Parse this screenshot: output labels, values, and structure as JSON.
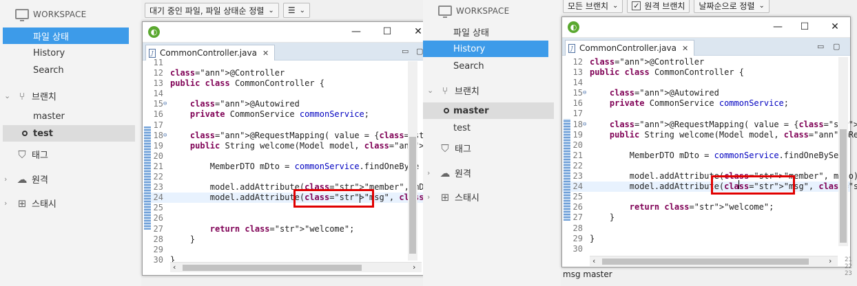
{
  "left": {
    "toolbar": {
      "filter_label": "대기 중인 파일, 파일 상태순 정렬",
      "view_label": "☰"
    },
    "sidebar": {
      "workspace": "WORKSPACE",
      "workspace_items": [
        "파일 상태",
        "History",
        "Search"
      ],
      "branch_label": "브랜치",
      "branches": [
        "master",
        "test"
      ],
      "tags_label": "태그",
      "remote_label": "원격",
      "stash_label": "스태시"
    },
    "editor": {
      "tab_label": "CommonController.java",
      "lines": [
        {
          "n": "11",
          "t": ""
        },
        {
          "n": "12",
          "t": "@Controller"
        },
        {
          "n": "13",
          "t": "public class CommonController {"
        },
        {
          "n": "14",
          "t": ""
        },
        {
          "n": "15",
          "t": "    @Autowired"
        },
        {
          "n": "16",
          "t": "    private CommonService commonService;"
        },
        {
          "n": "17",
          "t": ""
        },
        {
          "n": "18",
          "t": "    @RequestMapping( value = {\"/\", \"/welcome\"} )"
        },
        {
          "n": "19",
          "t": "    public String welcome(Model model, @RequestPar"
        },
        {
          "n": "20",
          "t": ""
        },
        {
          "n": "21",
          "t": "        MemberDTO mDto = commonService.findOneBySe"
        },
        {
          "n": "22",
          "t": ""
        },
        {
          "n": "23",
          "t": "        model.addAttribute(\"member\", mDto);"
        },
        {
          "n": "24",
          "t": "        model.addAttribute(\"msg\", \"test\");"
        },
        {
          "n": "25",
          "t": ""
        },
        {
          "n": "26",
          "t": ""
        },
        {
          "n": "27",
          "t": "        return \"welcome\";"
        },
        {
          "n": "28",
          "t": "    }"
        },
        {
          "n": "29",
          "t": ""
        },
        {
          "n": "30",
          "t": "}"
        }
      ]
    }
  },
  "right": {
    "toolbar": {
      "branch_filter": "모든 브랜치",
      "remote_check": "원격 브랜치",
      "sort_label": "날짜순으로 정렬"
    },
    "sidebar": {
      "workspace": "WORKSPACE",
      "workspace_items": [
        "파일 상태",
        "History",
        "Search"
      ],
      "branch_label": "브랜치",
      "branches": [
        "master",
        "test"
      ],
      "tags_label": "태그",
      "remote_label": "원격",
      "stash_label": "스태시"
    },
    "editor": {
      "tab_label": "CommonController.java",
      "lines": [
        {
          "n": "12",
          "t": "@Controller"
        },
        {
          "n": "13",
          "t": "public class CommonController {"
        },
        {
          "n": "14",
          "t": ""
        },
        {
          "n": "15",
          "t": "    @Autowired"
        },
        {
          "n": "16",
          "t": "    private CommonService commonService;"
        },
        {
          "n": "17",
          "t": ""
        },
        {
          "n": "18",
          "t": "    @RequestMapping( value = {\"/\", \"/welcome\"} )"
        },
        {
          "n": "19",
          "t": "    public String welcome(Model model, @RequestPar"
        },
        {
          "n": "20",
          "t": ""
        },
        {
          "n": "21",
          "t": "        MemberDTO mDto = commonService.findOneBySe"
        },
        {
          "n": "22",
          "t": ""
        },
        {
          "n": "23",
          "t": "        model.addAttribute(\"member\", mDto);"
        },
        {
          "n": "24",
          "t": "        model.addAttribute(\"msg\", \"master\");"
        },
        {
          "n": "25",
          "t": ""
        },
        {
          "n": "26",
          "t": "        return \"welcome\";"
        },
        {
          "n": "27",
          "t": "    }"
        },
        {
          "n": "28",
          "t": ""
        },
        {
          "n": "29",
          "t": "}"
        },
        {
          "n": "30",
          "t": ""
        }
      ]
    },
    "output_text": "msg master",
    "side_numbers": [
      "21",
      "22",
      "23"
    ]
  },
  "colors": {
    "selection": "#3d9be9",
    "keyword": "#7f0055",
    "string": "#2a00ff",
    "field": "#0000c0",
    "highlight_box": "#e00000"
  }
}
